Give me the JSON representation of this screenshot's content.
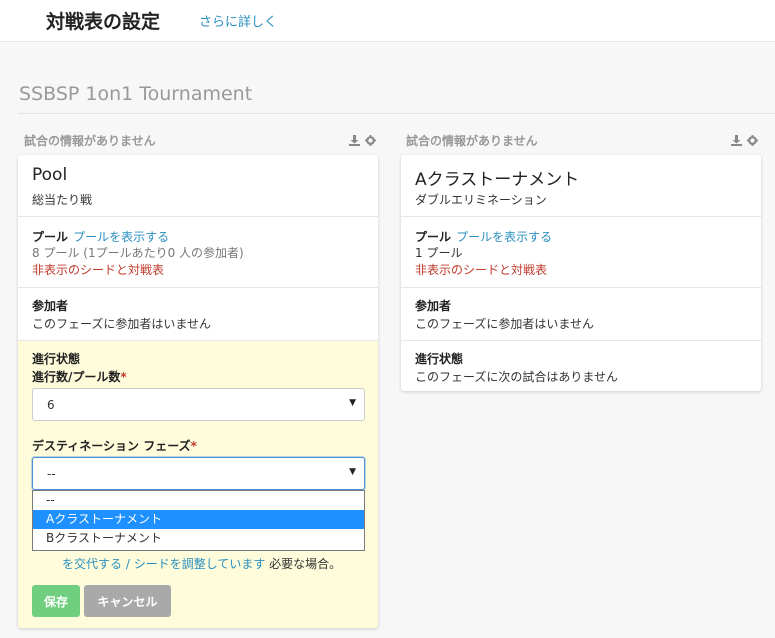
{
  "header": {
    "title": "対戦表の設定",
    "details_link": "さらに詳しく"
  },
  "tournament": {
    "name": "SSBSP 1on1 Tournament"
  },
  "columns": [
    {
      "no_match_info": "試合の情報がありません",
      "tools_icons": [
        "download-icon",
        "gear-icon"
      ],
      "card": {
        "title": "Pool",
        "subtitle": "総当たり戦",
        "pools": {
          "label": "プール",
          "link": "プールを表示する",
          "count": "8 プール (1プールあたり0 人の参加者)",
          "hidden_seeds": "非表示のシードと対戦表"
        },
        "participants": {
          "label": "参加者",
          "text": "このフェーズに参加者はいません"
        },
        "progress": {
          "label": "進行状態",
          "advance_label": "進行数/プール数",
          "advance_value": "6",
          "destination_label": "デスティネーション フェーズ",
          "destination_value": "--",
          "destination_options": [
            "--",
            "Aクラストーナメント",
            "Bクラストーナメント"
          ],
          "highlighted_option": "Aクラストーナメント",
          "help_prefix": "",
          "help_link_1": "を交代する",
          "help_sep": " / ",
          "help_link_2": "シードを調整しています",
          "help_suffix": " 必要な場合。",
          "save_label": "保存",
          "cancel_label": "キャンセル"
        }
      }
    },
    {
      "no_match_info": "試合の情報がありません",
      "tools_icons": [
        "download-icon",
        "gear-icon"
      ],
      "card": {
        "title": "Aクラストーナメント",
        "subtitle": "ダブルエリミネーション",
        "pools": {
          "label": "プール",
          "link": "プールを表示する",
          "count": "1 プール",
          "hidden_seeds": "非表示のシードと対戦表"
        },
        "participants": {
          "label": "参加者",
          "text": "このフェーズに参加者はいません"
        },
        "progress": {
          "label": "進行状態",
          "text": "このフェーズに次の試合はありません"
        }
      }
    }
  ],
  "colors": {
    "link": "#2a8fbf",
    "danger": "#c0392b",
    "save": "#6fcf7f",
    "cancel": "#a9a9a9",
    "progress_bg": "#fefcdb",
    "dropdown_highlight": "#1e90ff"
  }
}
